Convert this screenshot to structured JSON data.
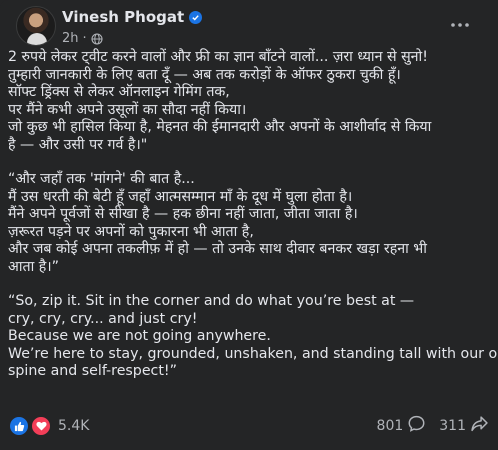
{
  "post": {
    "author": "Vinesh Phogat",
    "time": "2h",
    "more_icon": "more-options-icon",
    "paragraphs": [
      [
        "2 रुपये लेकर ट्वीट करने वालों और फ्री का ज्ञान बाँटने वालों... ज़रा ध्यान से सुनो!",
        "तुम्हारी जानकारी के लिए बता दूँ — अब तक करोड़ों के ऑफर ठुकरा चुकी हूँ।",
        "सॉफ्ट ड्रिंक्स से लेकर ऑनलाइन गेमिंग तक,",
        "पर मैंने कभी अपने उसूलों का सौदा नहीं किया।",
        "जो कुछ भी हासिल किया है, मेहनत की ईमानदारी और अपनों के आशीर्वाद से किया",
        "है — और उसी पर गर्व है।\""
      ],
      [
        "“और जहाँ तक 'मांगने' की बात है...",
        "मैं उस धरती की बेटी हूँ जहाँ आत्मसम्मान माँ के दूध में घुला होता है।",
        "मैंने अपने पूर्वजों से सीखा है — हक छीना नहीं जाता, जीता जाता है।",
        "ज़रूरत पड़ने पर अपनों को पुकारना भी आता है,",
        "और जब कोई अपना तकलीफ़ में हो — तो उनके साथ दीवार बनकर खड़ा रहना भी",
        "आता है।”"
      ],
      [
        "“So, zip it. Sit in the corner and do what you’re best at —",
        "cry, cry, cry... and just cry!",
        "Because we are not going anywhere.",
        "We’re here to stay, grounded, unshaken, and standing tall with our own",
        "spine and self-respect!”"
      ]
    ]
  },
  "footer": {
    "reaction_count": "5.4K",
    "comments": "801",
    "shares": "311"
  },
  "colors": {
    "background": "#242526",
    "text": "#e4e6eb",
    "secondary": "#b0b3b8",
    "like_blue": "#1b74e4",
    "love_red": "#f33e58"
  }
}
